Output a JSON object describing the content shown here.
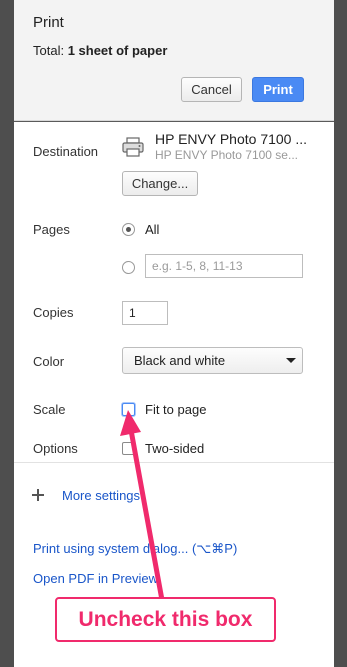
{
  "header": {
    "title": "Print",
    "total_prefix": "Total: ",
    "total_value": "1 sheet of paper",
    "cancel_label": "Cancel",
    "print_label": "Print"
  },
  "destination": {
    "label": "Destination",
    "printer_name": "HP ENVY Photo 7100 ...",
    "printer_sub": "HP ENVY Photo 7100 se...",
    "change_label": "Change...",
    "icon": "printer-icon"
  },
  "pages": {
    "label": "Pages",
    "all_label": "All",
    "range_placeholder": "e.g. 1-5, 8, 11-13"
  },
  "copies": {
    "label": "Copies",
    "value": "1"
  },
  "color": {
    "label": "Color",
    "selected": "Black and white"
  },
  "scale": {
    "label": "Scale",
    "fit_label": "Fit to page"
  },
  "options": {
    "label": "Options",
    "two_sided_label": "Two-sided"
  },
  "more_settings": {
    "label": "More settings"
  },
  "links": {
    "system_dialog": "Print using system dialog... (⌥⌘P)",
    "open_pdf": "Open PDF in Preview"
  },
  "annotation": {
    "text": "Uncheck this box",
    "color": "#f02a6c"
  },
  "colors": {
    "accent": "#4a8af4",
    "link": "#1a56c9"
  }
}
